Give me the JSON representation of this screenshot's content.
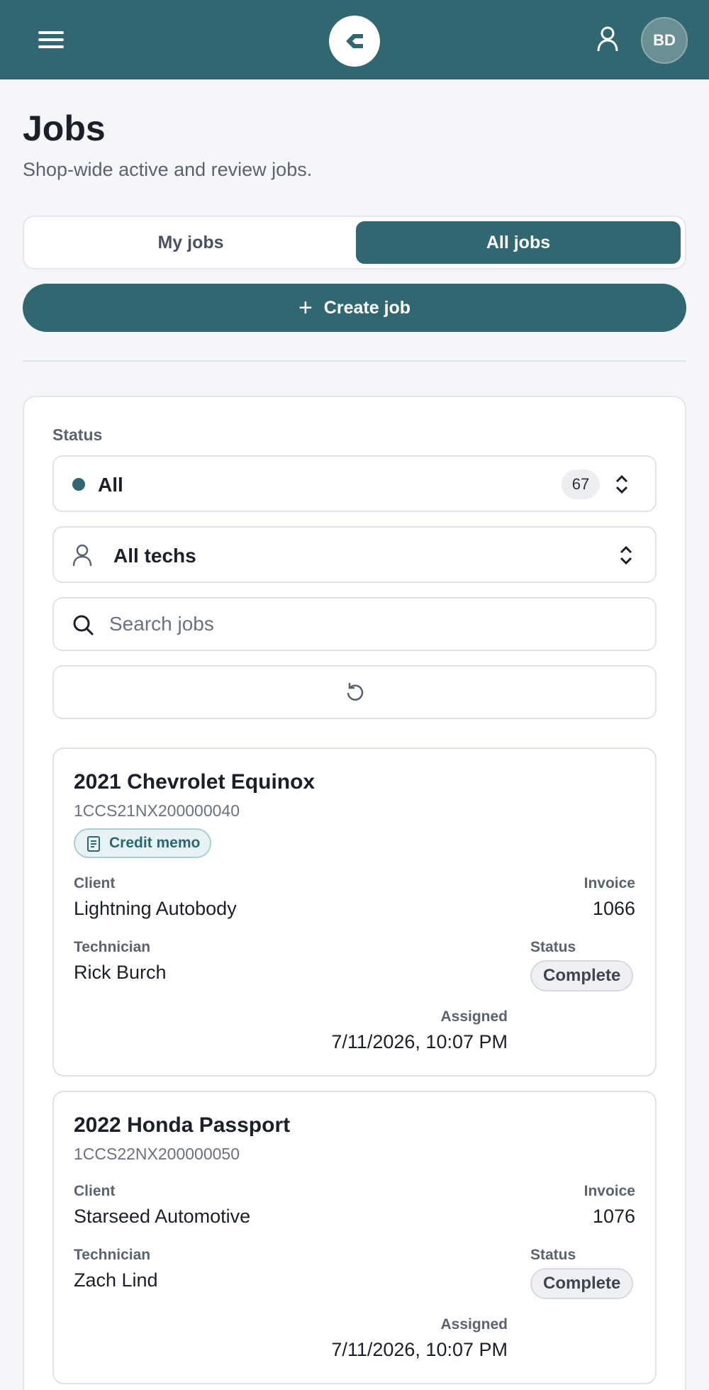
{
  "header": {
    "menu_icon": "hamburger-icon",
    "logo_icon": "brand-logo",
    "user_icon": "person-icon",
    "avatar_initials": "BD",
    "brand_color": "#316771"
  },
  "page": {
    "title": "Jobs",
    "subtitle": "Shop-wide active and review jobs."
  },
  "tabs": {
    "my_jobs": "My jobs",
    "all_jobs": "All jobs",
    "active": "All jobs"
  },
  "create_button": {
    "label": "Create job",
    "icon": "plus-icon"
  },
  "filters": {
    "status_label": "Status",
    "status_value": "All",
    "status_count": "67",
    "tech_value": "All techs",
    "search_placeholder": "Search jobs",
    "refresh_icon": "refresh-icon"
  },
  "jobs": [
    {
      "title": "2021 Chevrolet Equinox",
      "vin": "1CCS21NX200000040",
      "badge": "Credit memo",
      "client_label": "Client",
      "client": "Lightning Autobody",
      "invoice_label": "Invoice",
      "invoice": "1066",
      "technician_label": "Technician",
      "technician": "Rick Burch",
      "status_label": "Status",
      "status": "Complete",
      "assigned_label": "Assigned",
      "assigned": "7/11/2026, 10:07 PM"
    },
    {
      "title": "2022 Honda Passport",
      "vin": "1CCS22NX200000050",
      "client_label": "Client",
      "client": "Starseed Automotive",
      "invoice_label": "Invoice",
      "invoice": "1076",
      "technician_label": "Technician",
      "technician": "Zach Lind",
      "status_label": "Status",
      "status": "Complete",
      "assigned_label": "Assigned",
      "assigned": "7/11/2026, 10:07 PM"
    }
  ]
}
